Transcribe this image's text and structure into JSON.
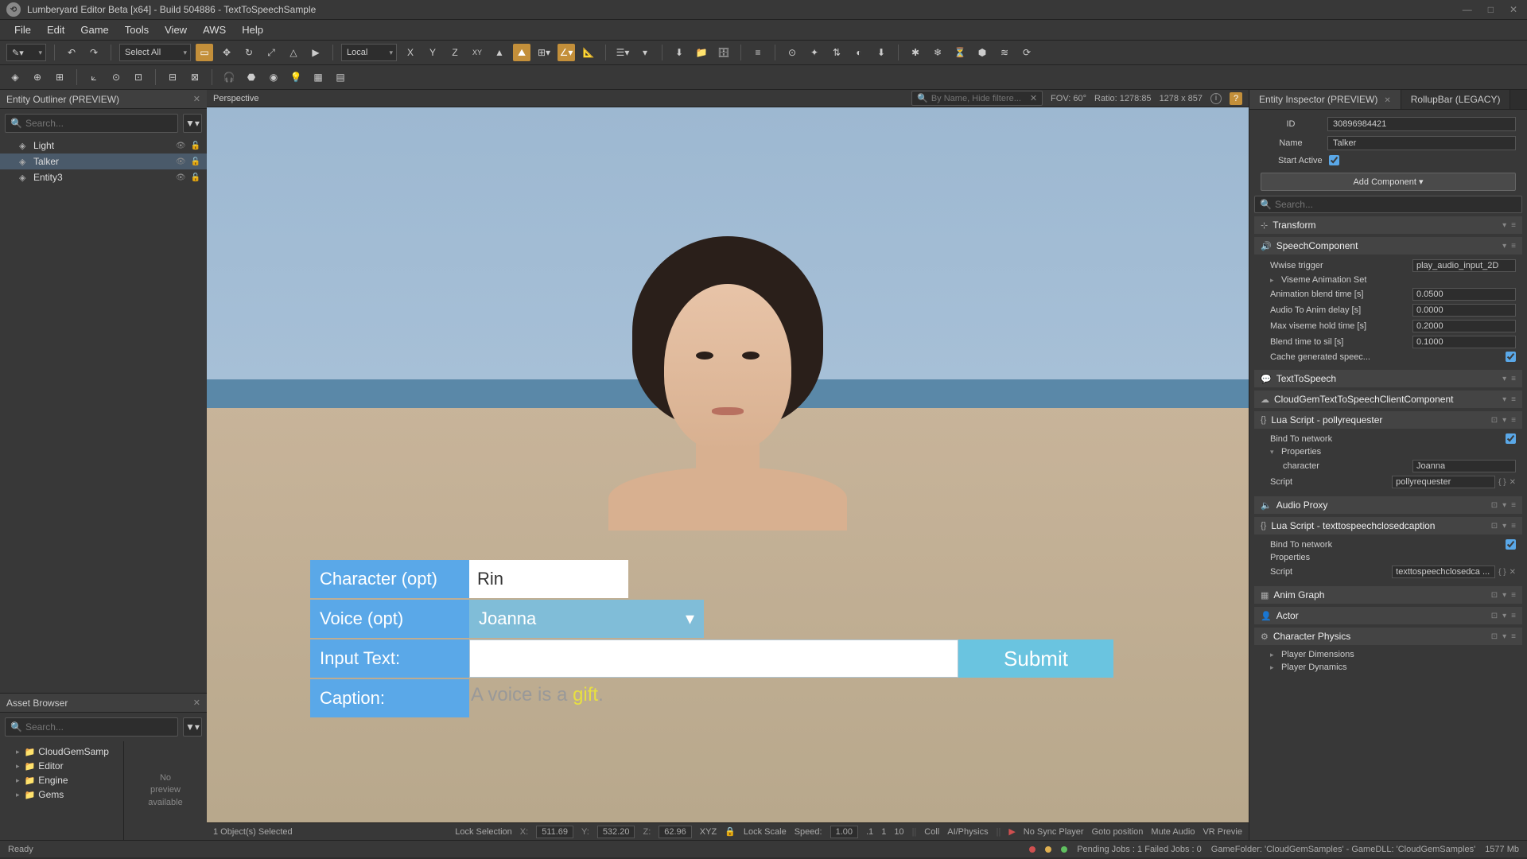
{
  "titlebar": {
    "title": "Lumberyard Editor Beta [x64] - Build 504886 - TextToSpeechSample"
  },
  "menu": {
    "items": [
      "File",
      "Edit",
      "Game",
      "Tools",
      "View",
      "AWS",
      "Help"
    ]
  },
  "toolbar1": {
    "select_all": "Select All",
    "coord_space": "Local"
  },
  "outliner": {
    "title": "Entity Outliner (PREVIEW)",
    "search_placeholder": "Search...",
    "items": [
      {
        "name": "Light",
        "selected": false
      },
      {
        "name": "Talker",
        "selected": true
      },
      {
        "name": "Entity3",
        "selected": false
      }
    ]
  },
  "asset_browser": {
    "title": "Asset Browser",
    "search_placeholder": "Search...",
    "folders": [
      "CloudGemSamp",
      "Editor",
      "Engine",
      "Gems"
    ],
    "preview": "No\npreview\navailable"
  },
  "viewport": {
    "label": "Perspective",
    "search_placeholder": "By Name, Hide filtere...",
    "fov": "FOV: 60°",
    "ratio": "Ratio:  1278:85",
    "dims": "1278 x 857",
    "tts": {
      "character_label": "Character (opt)",
      "character_value": "Rin",
      "voice_label": "Voice (opt)",
      "voice_value": "Joanna",
      "input_label": "Input Text:",
      "input_value": "",
      "submit": "Submit",
      "caption_label": "Caption:",
      "caption_pre": "A voice is a ",
      "caption_hl": "gift",
      "caption_post": "."
    },
    "status": {
      "selected": "1 Object(s) Selected",
      "lock_selection": "Lock Selection",
      "x": "511.69",
      "y": "532.20",
      "z": "62.96",
      "xyz": "XYZ",
      "lock_scale": "Lock Scale",
      "speed_lbl": "Speed:",
      "speed_val": "1.00",
      "btns": [
        ".1",
        "1",
        "10"
      ],
      "toggles": [
        "Coll",
        "AI/Physics"
      ],
      "right": [
        "No Sync Player",
        "Goto position",
        "Mute Audio",
        "VR Previe"
      ]
    }
  },
  "inspector": {
    "tab1": "Entity Inspector (PREVIEW)",
    "tab2": "RollupBar (LEGACY)",
    "id_label": "ID",
    "id_value": "30896984421",
    "name_label": "Name",
    "name_value": "Talker",
    "start_active_label": "Start Active",
    "add_component": "Add Component ▾",
    "search_placeholder": "Search...",
    "components": {
      "transform": "Transform",
      "speech": {
        "title": "SpeechComponent",
        "wwise_trigger_lbl": "Wwise trigger",
        "wwise_trigger_val": "play_audio_input_2D",
        "viseme_set": "Viseme Animation Set",
        "blend_time_lbl": "Animation blend time [s]",
        "blend_time_val": "0.0500",
        "audio_delay_lbl": "Audio To Anim delay [s]",
        "audio_delay_val": "0.0000",
        "max_hold_lbl": "Max viseme hold time [s]",
        "max_hold_val": "0.2000",
        "blend_sil_lbl": "Blend time to sil [s]",
        "blend_sil_val": "0.1000",
        "cache_lbl": "Cache generated speec..."
      },
      "tts": "TextToSpeech",
      "cloudgem": "CloudGemTextToSpeechClientComponent",
      "lua1": {
        "title": "Lua Script - pollyrequester",
        "bind_lbl": "Bind To network",
        "props_lbl": "Properties",
        "char_lbl": "character",
        "char_val": "Joanna",
        "script_lbl": "Script",
        "script_val": "pollyrequester"
      },
      "audio_proxy": "Audio Proxy",
      "lua2": {
        "title": "Lua Script - texttospeechclosedcaption",
        "bind_lbl": "Bind To network",
        "props_lbl": "Properties",
        "script_lbl": "Script",
        "script_val": "texttospeechclosedca ..."
      },
      "anim_graph": "Anim Graph",
      "actor": "Actor",
      "char_physics": {
        "title": "Character Physics",
        "dims": "Player Dimensions",
        "dyn": "Player Dynamics"
      }
    }
  },
  "statusbar": {
    "left": "Ready",
    "pending": "Pending Jobs : 1   Failed Jobs : 0",
    "folder": "GameFolder: 'CloudGemSamples' - GameDLL: 'CloudGemSamples'",
    "mem": "1577 Mb"
  }
}
